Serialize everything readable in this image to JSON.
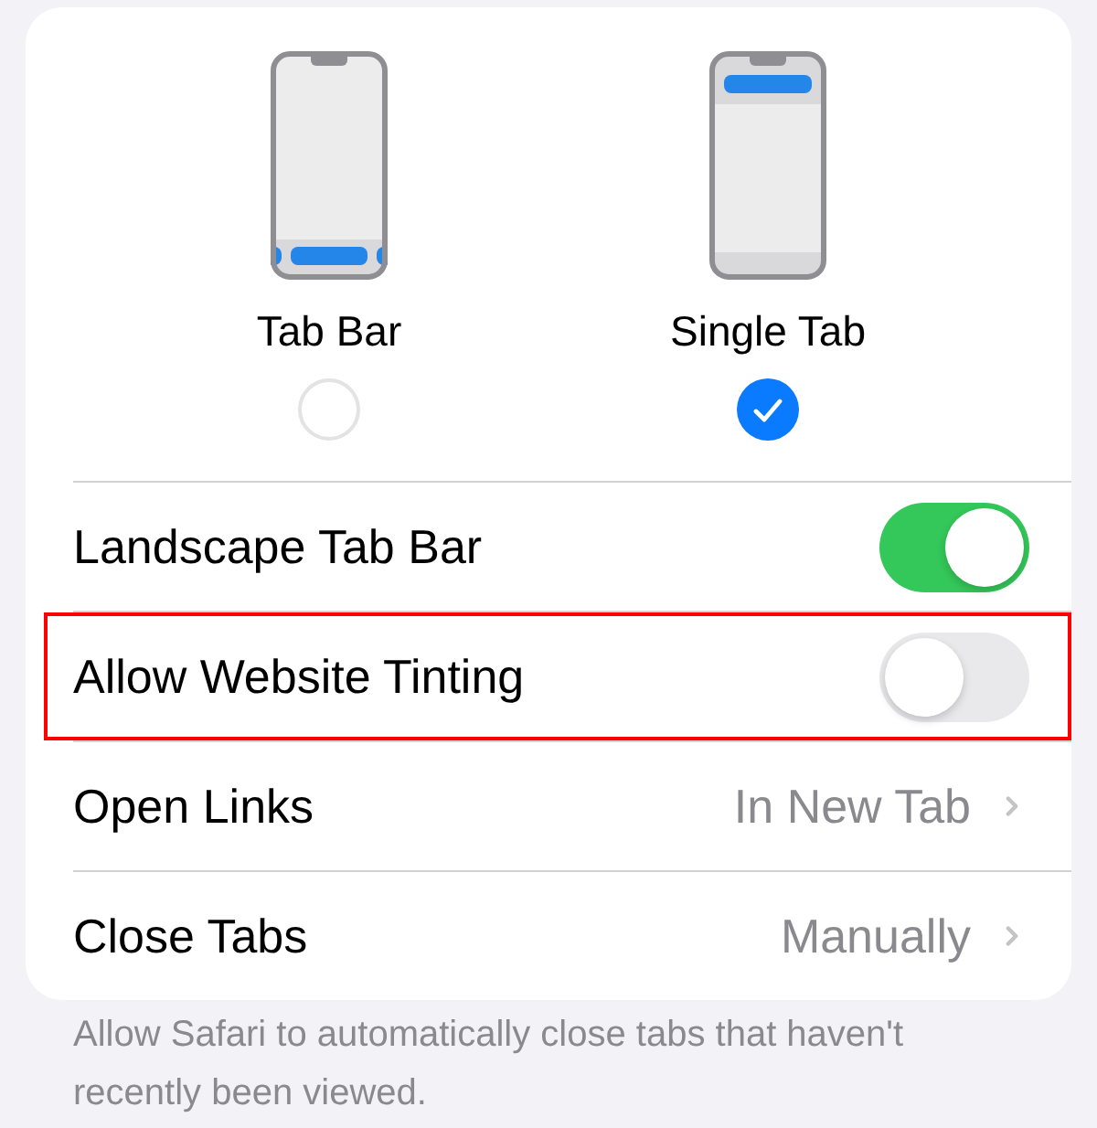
{
  "layout_options": [
    {
      "label": "Tab Bar",
      "kind": "tab-bar",
      "selected": false
    },
    {
      "label": "Single Tab",
      "kind": "single-tab",
      "selected": true
    }
  ],
  "settings": [
    {
      "kind": "toggle",
      "label": "Landscape Tab Bar",
      "on": true,
      "highlighted": false
    },
    {
      "kind": "toggle",
      "label": "Allow Website Tinting",
      "on": false,
      "highlighted": true
    },
    {
      "kind": "link",
      "label": "Open Links",
      "value": "In New Tab",
      "highlighted": false
    },
    {
      "kind": "link",
      "label": "Close Tabs",
      "value": "Manually",
      "highlighted": false
    }
  ],
  "footer": "Allow Safari to automatically close tabs that haven't recently been viewed."
}
